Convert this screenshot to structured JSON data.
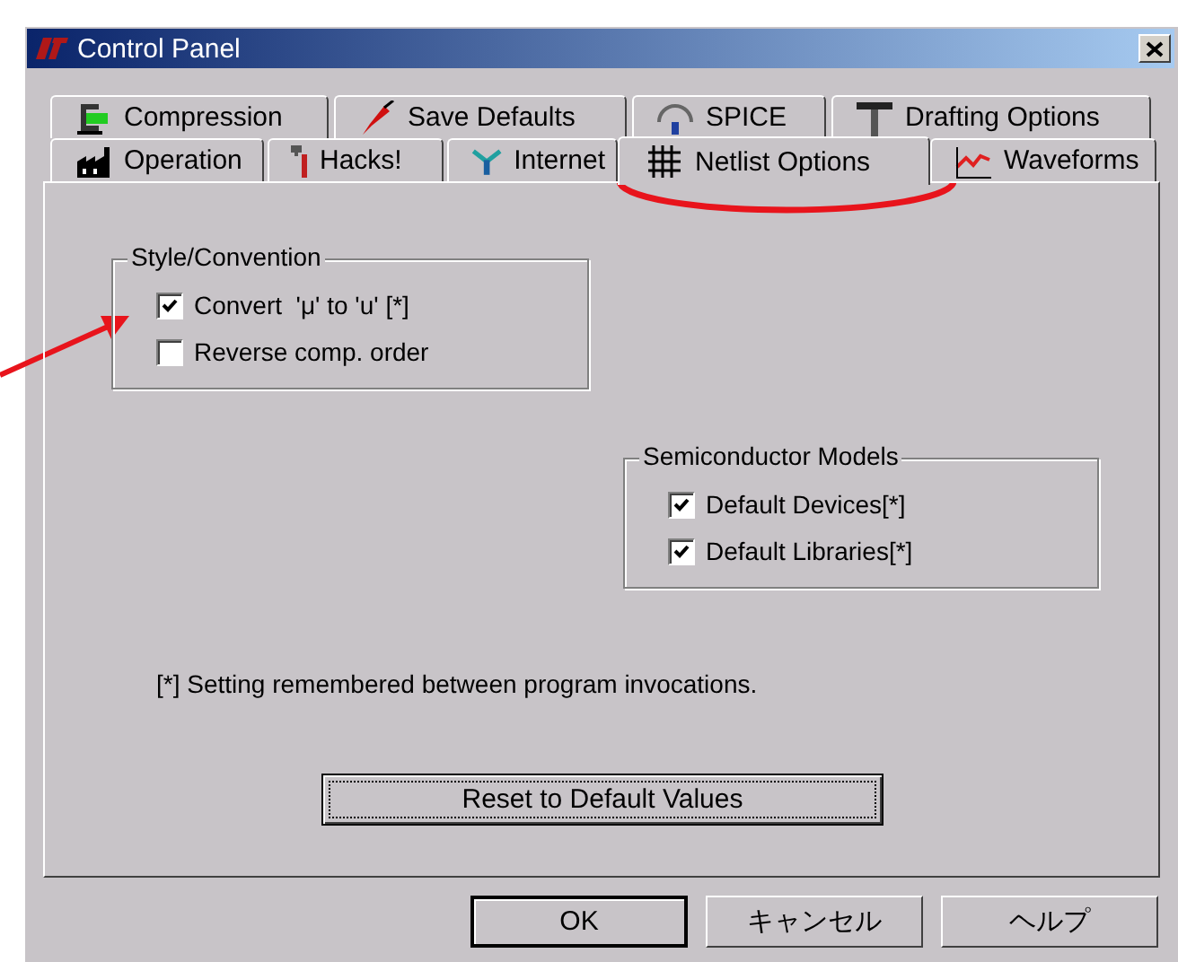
{
  "window": {
    "title": "Control Panel"
  },
  "tab_rows": [
    [
      {
        "label": "Compression",
        "selected": false
      },
      {
        "label": "Save Defaults",
        "selected": false
      },
      {
        "label": "SPICE",
        "selected": false
      },
      {
        "label": "Drafting Options",
        "selected": false
      }
    ],
    [
      {
        "label": "Operation",
        "selected": false
      },
      {
        "label": "Hacks!",
        "selected": false
      },
      {
        "label": "Internet",
        "selected": false
      },
      {
        "label": "Netlist Options",
        "selected": true
      },
      {
        "label": "Waveforms",
        "selected": false
      }
    ]
  ],
  "panel": {
    "groups": [
      {
        "title": "Style/Convention",
        "options": [
          {
            "label": "Convert  'μ' to 'u' [*]",
            "checked": true
          },
          {
            "label": "Reverse comp. order",
            "checked": false
          }
        ]
      },
      {
        "title": "Semiconductor Models",
        "options": [
          {
            "label": "Default Devices[*]",
            "checked": true
          },
          {
            "label": "Default Libraries[*]",
            "checked": true
          }
        ]
      }
    ],
    "note": "[*] Setting remembered between program invocations.",
    "reset_button": "Reset to Default Values"
  },
  "buttons": [
    "OK",
    "キャンセル",
    "ヘルプ"
  ]
}
